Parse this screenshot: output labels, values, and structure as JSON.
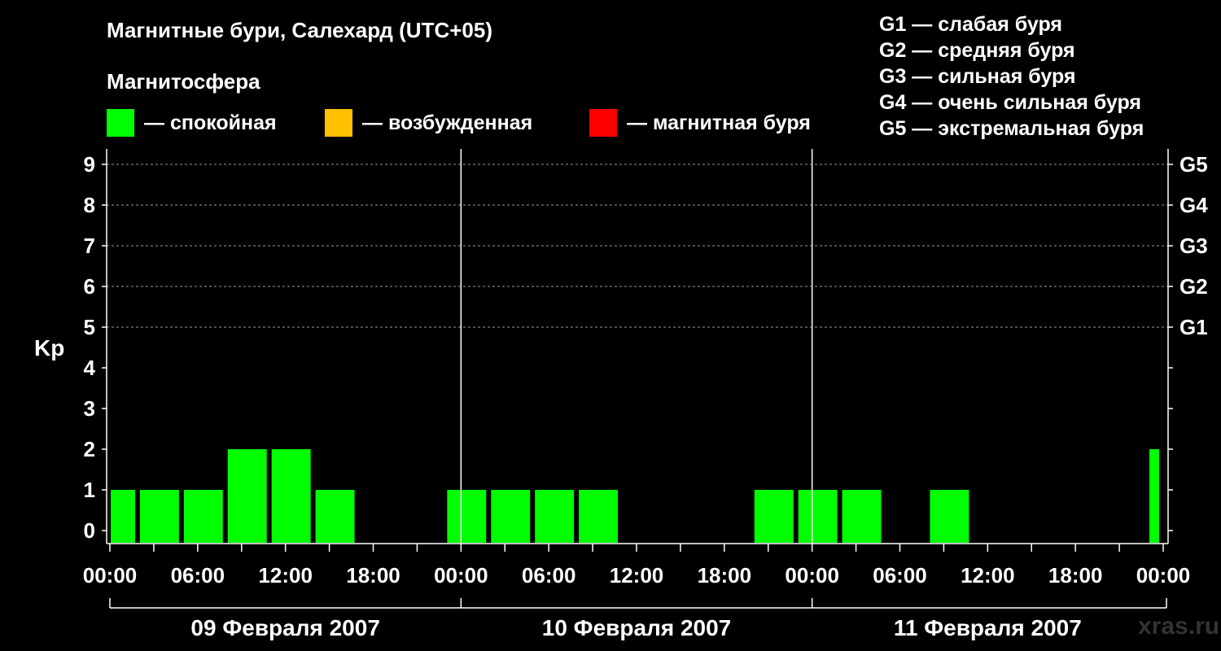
{
  "title": "Магнитные бури, Салехард (UTC+05)",
  "subtitle": "Магнитосфера",
  "legend": [
    {
      "label": "— спокойная",
      "color": "#00ff00"
    },
    {
      "label": "— возбужденная",
      "color": "#ffc000"
    },
    {
      "label": "— магнитная буря",
      "color": "#ff0000"
    }
  ],
  "g_scale": [
    "G1 — слабая буря",
    "G2 — средняя буря",
    "G3 — сильная буря",
    "G4 — очень сильная буря",
    "G5 — экстремальная буря"
  ],
  "watermark": "xras.ru",
  "chart_data": {
    "type": "bar",
    "ylabel": "Kp",
    "ylim": [
      0,
      9
    ],
    "y_ticks": [
      0,
      1,
      2,
      3,
      4,
      5,
      6,
      7,
      8,
      9
    ],
    "g_ticks": [
      {
        "kp": 5,
        "label": "G1"
      },
      {
        "kp": 6,
        "label": "G2"
      },
      {
        "kp": 7,
        "label": "G3"
      },
      {
        "kp": 8,
        "label": "G4"
      },
      {
        "kp": 9,
        "label": "G5"
      }
    ],
    "x_range_hours": [
      0,
      72
    ],
    "x_tick_labels": [
      "00:00",
      "06:00",
      "12:00",
      "18:00",
      "00:00",
      "06:00",
      "12:00",
      "18:00",
      "00:00",
      "06:00",
      "12:00",
      "18:00",
      "00:00"
    ],
    "days": [
      "09 Февраля 2007",
      "10 Февраля 2007",
      "11 Февраля 2007"
    ],
    "bar_color": "#00ff00",
    "grid": "dashed at Kp 5-9",
    "bars": [
      {
        "start": "09 Февраля 2007 00:00",
        "end": "09 Февраля 2007 02:00",
        "kp": 1
      },
      {
        "start": "09 Февраля 2007 02:00",
        "end": "09 Февраля 2007 05:00",
        "kp": 1
      },
      {
        "start": "09 Февраля 2007 05:00",
        "end": "09 Февраля 2007 08:00",
        "kp": 1
      },
      {
        "start": "09 Февраля 2007 08:00",
        "end": "09 Февраля 2007 11:00",
        "kp": 2
      },
      {
        "start": "09 Февраля 2007 11:00",
        "end": "09 Февраля 2007 14:00",
        "kp": 2
      },
      {
        "start": "09 Февраля 2007 14:00",
        "end": "09 Февраля 2007 17:00",
        "kp": 1
      },
      {
        "start": "09 Февраля 2007 17:00",
        "end": "09 Февраля 2007 20:00",
        "kp": 0
      },
      {
        "start": "09 Февраля 2007 20:00",
        "end": "09 Февраля 2007 23:00",
        "kp": 0
      },
      {
        "start": "09 Февраля 2007 23:00",
        "end": "10 Февраля 2007 02:00",
        "kp": 1
      },
      {
        "start": "10 Февраля 2007 02:00",
        "end": "10 Февраля 2007 05:00",
        "kp": 1
      },
      {
        "start": "10 Февраля 2007 05:00",
        "end": "10 Февраля 2007 08:00",
        "kp": 1
      },
      {
        "start": "10 Февраля 2007 08:00",
        "end": "10 Февраля 2007 11:00",
        "kp": 1
      },
      {
        "start": "10 Февраля 2007 11:00",
        "end": "10 Февраля 2007 14:00",
        "kp": 0
      },
      {
        "start": "10 Февраля 2007 14:00",
        "end": "10 Февраля 2007 17:00",
        "kp": 0
      },
      {
        "start": "10 Февраля 2007 17:00",
        "end": "10 Февраля 2007 20:00",
        "kp": 0
      },
      {
        "start": "10 Февраля 2007 20:00",
        "end": "10 Февраля 2007 23:00",
        "kp": 1
      },
      {
        "start": "10 Февраля 2007 23:00",
        "end": "11 Февраля 2007 02:00",
        "kp": 1
      },
      {
        "start": "11 Февраля 2007 02:00",
        "end": "11 Февраля 2007 05:00",
        "kp": 1
      },
      {
        "start": "11 Февраля 2007 05:00",
        "end": "11 Февраля 2007 08:00",
        "kp": 0
      },
      {
        "start": "11 Февраля 2007 08:00",
        "end": "11 Февраля 2007 11:00",
        "kp": 1
      },
      {
        "start": "11 Февраля 2007 11:00",
        "end": "11 Февраля 2007 14:00",
        "kp": 0
      },
      {
        "start": "11 Февраля 2007 14:00",
        "end": "11 Февраля 2007 17:00",
        "kp": 0
      },
      {
        "start": "11 Февраля 2007 17:00",
        "end": "11 Февраля 2007 20:00",
        "kp": 0
      },
      {
        "start": "11 Февраля 2007 20:00",
        "end": "11 Февраля 2007 23:00",
        "kp": 0
      },
      {
        "start": "11 Февраля 2007 23:00",
        "end": "12 Февраля 2007 00:00",
        "kp": 2
      }
    ]
  }
}
